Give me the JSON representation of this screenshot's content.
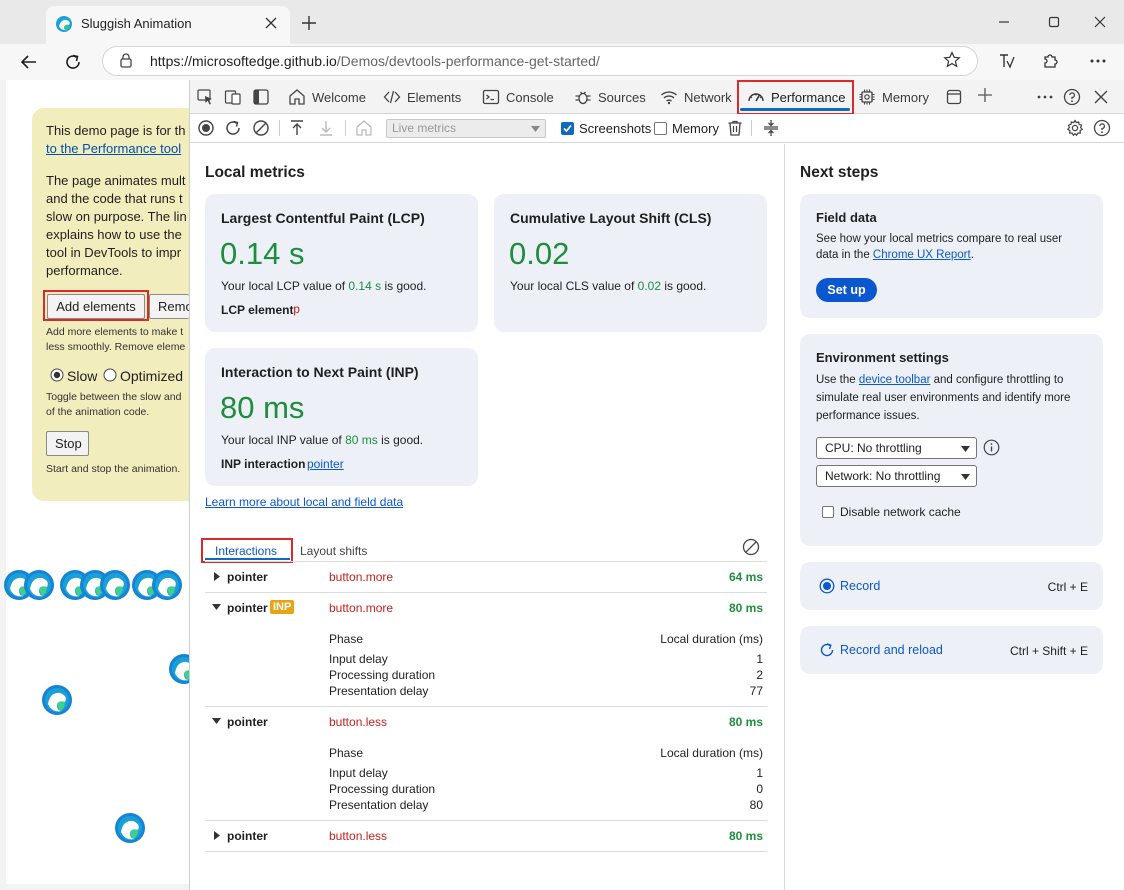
{
  "browser": {
    "tab_title": "Sluggish Animation",
    "url_host": "https://microsoftedge.github.io",
    "url_path": "/Demos/devtools-performance-get-started/"
  },
  "page": {
    "intro_text": "This demo page is for th",
    "intro_link": "to the Performance tool",
    "para": [
      "The page animates mult",
      "and the code that runs t",
      "slow on purpose. The lin",
      "explains how to use the",
      "tool in DevTools to impr",
      "performance."
    ],
    "add_button": "Add elements",
    "remove_button": "Remo",
    "add_help": [
      "Add more elements to make t",
      "less smoothly. Remove eleme"
    ],
    "radio_slow": "Slow",
    "radio_optimized": "Optimized",
    "toggle_help": [
      "Toggle between the slow and",
      "of the animation code."
    ],
    "stop_button": "Stop",
    "stop_help": "Start and stop the animation."
  },
  "devtools": {
    "tabs": {
      "welcome": "Welcome",
      "elements": "Elements",
      "console": "Console",
      "sources": "Sources",
      "network": "Network",
      "performance": "Performance",
      "memory": "Memory"
    },
    "toolbar": {
      "live_metrics": "Live metrics",
      "screenshots": "Screenshots",
      "memory": "Memory",
      "screenshots_checked": true,
      "memory_checked": false
    }
  },
  "local_metrics": {
    "heading": "Local metrics",
    "lcp": {
      "title": "Largest Contentful Paint (LCP)",
      "value": "0.14 s",
      "text_pre": "Your local LCP value of ",
      "text_val": "0.14 s",
      "text_post": " is good.",
      "element_label": "LCP element",
      "element_tag": "p"
    },
    "cls": {
      "title": "Cumulative Layout Shift (CLS)",
      "value": "0.02",
      "text_pre": "Your local CLS value of ",
      "text_val": "0.02",
      "text_post": " is good."
    },
    "inp": {
      "title": "Interaction to Next Paint (INP)",
      "value": "80 ms",
      "text_pre": "Your local INP value of ",
      "text_val": "80 ms",
      "text_post": " is good.",
      "interaction_label": "INP interaction",
      "interaction_link": "pointer"
    },
    "learn_more": "Learn more about local and field data"
  },
  "interactions": {
    "tab_interactions": "Interactions",
    "tab_layout_shifts": "Layout shifts",
    "rows": [
      {
        "type": "pointer",
        "target": "button.more",
        "time": "64 ms",
        "expanded": false,
        "inp": false
      },
      {
        "type": "pointer",
        "badge": "INP",
        "target": "button.more",
        "time": "80 ms",
        "expanded": true,
        "inp": true,
        "phase_header": "Phase",
        "duration_header": "Local duration (ms)",
        "phases": [
          {
            "name": "Input delay",
            "value": "1"
          },
          {
            "name": "Processing duration",
            "value": "2"
          },
          {
            "name": "Presentation delay",
            "value": "77"
          }
        ]
      },
      {
        "type": "pointer",
        "target": "button.less",
        "time": "80 ms",
        "expanded": true,
        "inp": false,
        "phase_header": "Phase",
        "duration_header": "Local duration (ms)",
        "phases": [
          {
            "name": "Input delay",
            "value": "1"
          },
          {
            "name": "Processing duration",
            "value": "0"
          },
          {
            "name": "Presentation delay",
            "value": "80"
          }
        ]
      },
      {
        "type": "pointer",
        "target": "button.less",
        "time": "80 ms",
        "expanded": false,
        "inp": false
      }
    ]
  },
  "next_steps": {
    "heading": "Next steps",
    "field_data": {
      "title": "Field data",
      "text1": "See how your local metrics compare to real user",
      "text2_pre": "data in the ",
      "text2_link": "Chrome UX Report",
      "text2_post": ".",
      "button": "Set up"
    },
    "env": {
      "title": "Environment settings",
      "line1_pre": "Use the ",
      "line1_link": "device toolbar",
      "line1_post": " and configure throttling to",
      "line2": "simulate real user environments and identify more",
      "line3": "performance issues.",
      "cpu": "CPU: No throttling",
      "network": "Network: No throttling",
      "disable_cache": "Disable network cache"
    },
    "record": {
      "label": "Record",
      "shortcut": "Ctrl + E"
    },
    "record_reload": {
      "label": "Record and reload",
      "shortcut": "Ctrl + Shift + E"
    }
  },
  "colors": {
    "accent": "#0f6cbd",
    "good": "#1e8e3e",
    "highlight_box": "#d92b2b",
    "card_bg": "#edf1f7",
    "demo_bg": "#f1edbc"
  }
}
